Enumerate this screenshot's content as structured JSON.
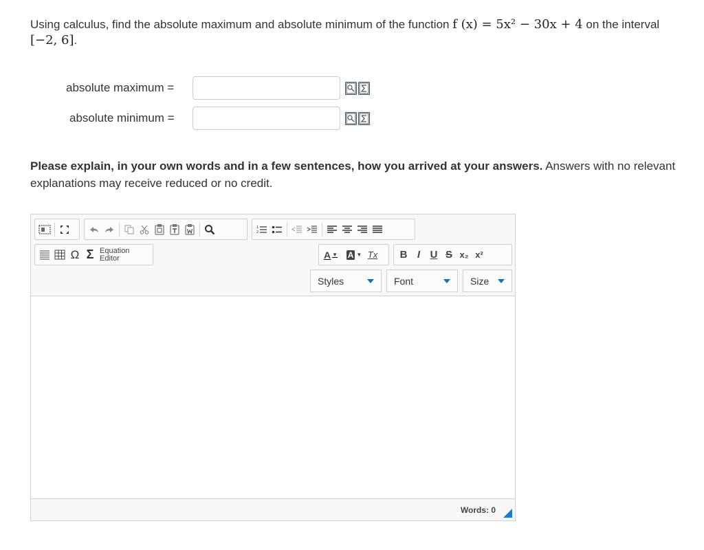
{
  "question": {
    "prefix": "Using calculus, find the absolute maximum and absolute minimum of the function ",
    "function_text": "f (x) = 5x² − 30x + 4",
    "middle": " on the interval",
    "interval": "[−2, 6]",
    "suffix": "."
  },
  "answers": [
    {
      "label": "absolute maximum =",
      "value": "",
      "placeholder": ""
    },
    {
      "label": "absolute minimum =",
      "value": "",
      "placeholder": ""
    }
  ],
  "explain": {
    "bold": "Please explain, in your own words and in a few sentences, how you arrived at your answers.",
    "normal": " Answers with no relevant explanations may receive reduced or no credit."
  },
  "editor": {
    "toolbar_row1": {
      "group1": [
        "source-icon",
        "maximize-icon"
      ],
      "group2": [
        "undo-icon",
        "redo-icon",
        "copy-icon",
        "cut-icon",
        "paste-icon",
        "paste-text-icon",
        "paste-word-icon",
        "find-icon"
      ],
      "group3": [
        "numbered-list-icon",
        "bulleted-list-icon",
        "outdent-icon",
        "indent-icon",
        "align-left-icon",
        "align-center-icon",
        "align-right-icon",
        "justify-icon"
      ]
    },
    "equation_editor_line1": "Equation",
    "equation_editor_line2": "Editor",
    "omega_symbol": "Ω",
    "sigma_symbol": "Σ",
    "format_buttons": {
      "text_color": "A",
      "background_color": "A",
      "remove_format": "Tx",
      "bold": "B",
      "italic": "I",
      "underline": "U",
      "strike": "S",
      "subscript": "x₂",
      "superscript": "x²"
    },
    "combos": {
      "styles": "Styles",
      "font": "Font",
      "size": "Size"
    },
    "word_count_label": "Words: 0"
  },
  "colors": {
    "accent": "#1f7ad6",
    "toolbar_bg": "#f8f8f8",
    "border": "#d1d1d1"
  }
}
